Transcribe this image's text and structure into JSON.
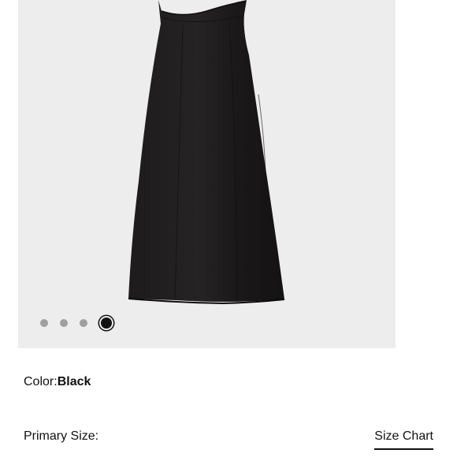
{
  "product": {
    "image_alt": "Black midi slip dress",
    "carousel": {
      "total": 4,
      "active": 4
    }
  },
  "color": {
    "label": "Color:",
    "value": "Black"
  },
  "size": {
    "label": "Primary Size:",
    "chart_link": "Size Chart"
  },
  "colors": {
    "background": "#ededed",
    "dress": "#1c1a1b",
    "dot_inactive": "#9f9f9f",
    "dot_active": "#111111"
  }
}
